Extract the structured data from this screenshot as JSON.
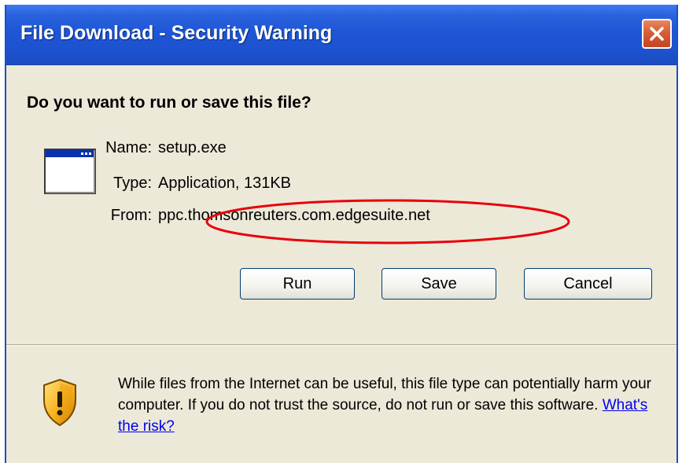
{
  "window": {
    "title": "File Download - Security Warning",
    "close_label": "close"
  },
  "dialog": {
    "question": "Do you want to run or save this file?",
    "file": {
      "name_label": "Name:",
      "name_value": "setup.exe",
      "type_label": "Type:",
      "type_value": "Application, 131KB",
      "from_label": "From:",
      "from_value": "ppc.thomsonreuters.com.edgesuite.net"
    },
    "buttons": {
      "run": "Run",
      "save": "Save",
      "cancel": "Cancel"
    },
    "warning": {
      "text": "While files from the Internet can be useful, this file type can potentially harm your computer. If you do not trust the source, do not run or save this software.",
      "link": "What's the risk?"
    }
  },
  "icons": {
    "application": "application-window-icon",
    "shield": "security-shield-warning-icon",
    "close": "close-icon"
  },
  "colors": {
    "titlebar": "#1d52cf",
    "window_bg": "#ece9d8",
    "close_button": "#d65a33",
    "highlight_ellipse": "#e8000b",
    "link": "#0000ee"
  }
}
